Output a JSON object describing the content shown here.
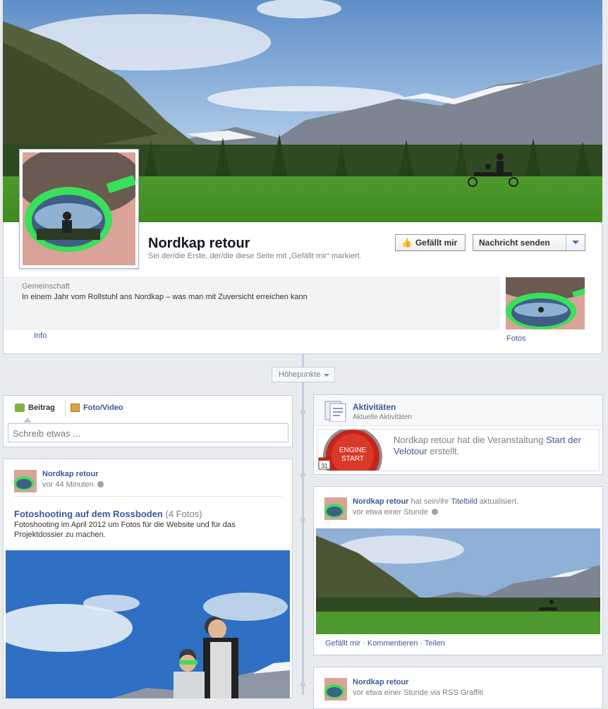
{
  "page": {
    "name": "Nordkap retour",
    "likes_note": "Sei der/die Erste, der/die diese Seite mit „Gefällt mir“ markiert.",
    "category": "Gemeinschaft",
    "description": "In einem Jahr vom Rollstuhl ans Nordkap – was man mit Zuversicht erreichen kann",
    "info_link": "Info",
    "photos_label": "Fotos"
  },
  "actions": {
    "like_label": "Gefällt mir",
    "message_label": "Nachricht senden"
  },
  "timeline": {
    "highlights_label": "Höhepunkte"
  },
  "composer": {
    "tab_post": "Beitrag",
    "tab_photo": "Foto/Video",
    "placeholder": "Schreib etwas ..."
  },
  "post1": {
    "author": "Nordkap retour",
    "time": "vor 44 Minuten",
    "album_title": "Fotoshooting auf dem Rossboden",
    "album_count": "(4 Fotos)",
    "album_desc": "Fotoshooting im April 2012 um Fotos für die Website und für das Projektdossier zu machen."
  },
  "activity": {
    "title": "Aktivitäten",
    "subtitle": "Aktuelle Aktivitäten",
    "badge_line1": "ENGINE",
    "badge_line2": "START",
    "calendar_day": "31",
    "text_before": "Nordkap retour hat die Veranstaltung ",
    "event_link": "Start der Velotour",
    "text_after": " erstellt."
  },
  "post2": {
    "author": "Nordkap retour",
    "mid_text": " hat sein/ihr ",
    "link_text": "Titelbild",
    "end_text": " aktualisiert.",
    "time": "vor etwa einer Stunde",
    "action_like": "Gefällt mir",
    "action_comment": "Kommentieren",
    "action_share": "Teilen",
    "separator": " · "
  },
  "post3": {
    "author": "Nordkap retour",
    "time": "vor etwa einer Stunde via RSS Graffiti"
  },
  "colors": {
    "link": "#3b5998",
    "border": "#c4cde0",
    "background": "#e9ebee",
    "sunglasses_green": "#39e05a"
  }
}
